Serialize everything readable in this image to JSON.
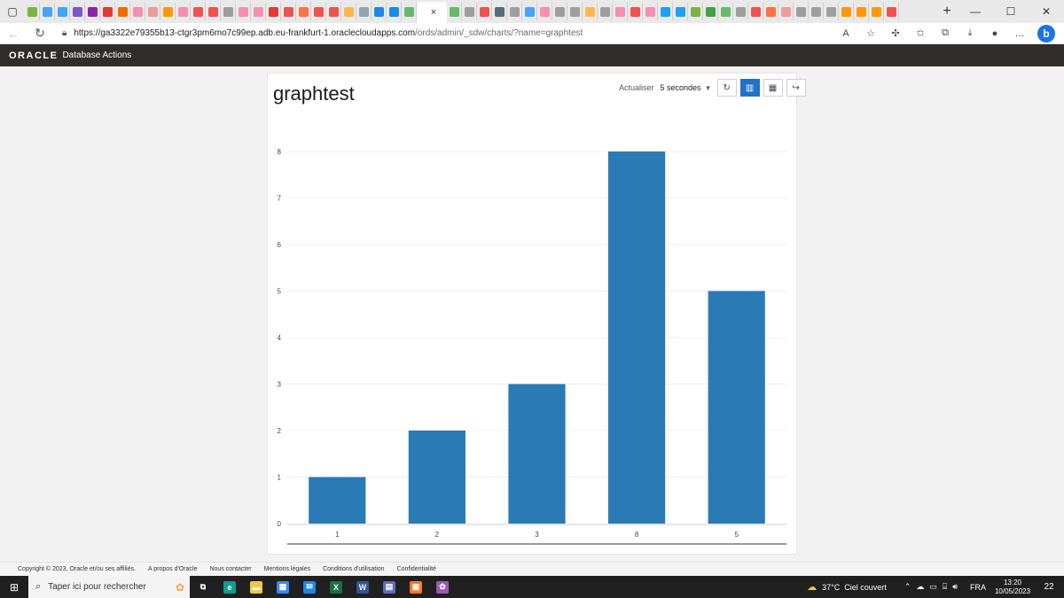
{
  "browser": {
    "tab_favicon_colors": [
      "#7cb342",
      "#42a5f5",
      "#42a5f5",
      "#7e57c2",
      "#8e24aa",
      "#e53935",
      "#ef6c00",
      "#f48fb1",
      "#ef9a9a",
      "#ff9800",
      "#f48fb1",
      "#ef5350",
      "#ef5350",
      "#9e9e9e",
      "#f48fb1",
      "#f48fb1",
      "#e53935",
      "#ef5350",
      "#ff7043",
      "#ef5350",
      "#ef5350",
      "#ffb74d",
      "#90a4ae",
      "#1e88e5",
      "#1e88e5",
      "#66bb6a"
    ],
    "right_favicon_colors": [
      "#66bb6a",
      "#9e9e9e",
      "#ef5350",
      "#546e7a",
      "#9e9e9e",
      "#42a5f5",
      "#f48fb1",
      "#9e9e9e",
      "#9e9e9e",
      "#ffb74d",
      "#9e9e9e",
      "#f48fb1",
      "#ef5350",
      "#f48fb1",
      "#1da1f2",
      "#1da1f2",
      "#7cb342",
      "#43a047",
      "#66bb6a",
      "#9e9e9e",
      "#ef5350",
      "#ff7043",
      "#ef9a9a",
      "#9e9e9e",
      "#9e9e9e",
      "#9e9e9e",
      "#ff9800",
      "#ff9800",
      "#ff9800",
      "#ef5350"
    ],
    "active_tab_close": "×",
    "new_tab": "+",
    "url_domain": "https://ga3322e79355b13-ctgr3pm6mo7c99ep.adb.eu-frankfurt-1.oraclecloudapps.com",
    "url_path": "/ords/admin/_sdw/charts/?name=graphtest",
    "bing_label": "b"
  },
  "app_header": {
    "logo": "ORACLE",
    "app_name": "Database Actions"
  },
  "chart_panel": {
    "title": "graphtest",
    "refresh_label": "Actualiser",
    "refresh_value": "5 secondes",
    "accent_color": "#1f72c8"
  },
  "chart_data": {
    "type": "bar",
    "categories": [
      "1",
      "2",
      "3",
      "8",
      "5"
    ],
    "values": [
      1,
      2,
      3,
      8,
      5
    ],
    "title": "graphtest",
    "xlabel": "",
    "ylabel": "",
    "ylim": [
      0,
      8
    ],
    "yticks": [
      0,
      1,
      2,
      3,
      4,
      5,
      6,
      7,
      8
    ],
    "grid": true,
    "bar_color": "#2a7ab5"
  },
  "footer": {
    "links": [
      "Copyright © 2023, Oracle et/ou ses affiliés.",
      "A propos d'Oracle",
      "Nous contacter",
      "Mentions légales",
      "Conditions d'utilisation",
      "Confidentialité"
    ]
  },
  "taskbar": {
    "search_placeholder": "Taper ici pour rechercher",
    "apps": [
      {
        "name": "task-view",
        "color": "#202020",
        "glyph": "⧉"
      },
      {
        "name": "edge",
        "color": "#0f9d8f",
        "glyph": "e"
      },
      {
        "name": "file-explorer",
        "color": "#f4c542",
        "glyph": "▬"
      },
      {
        "name": "store",
        "color": "#3a86ff",
        "glyph": "▦"
      },
      {
        "name": "mail",
        "color": "#1e88e5",
        "glyph": "✉"
      },
      {
        "name": "excel",
        "color": "#1d6f42",
        "glyph": "X"
      },
      {
        "name": "word",
        "color": "#2b579a",
        "glyph": "W"
      },
      {
        "name": "calculator",
        "color": "#5c6bc0",
        "glyph": "▤"
      },
      {
        "name": "xampp",
        "color": "#fb7a24",
        "glyph": "▣"
      },
      {
        "name": "app",
        "color": "#9b59b6",
        "glyph": "✿"
      }
    ],
    "weather_temp": "37°C",
    "weather_text": "Ciel couvert",
    "language": "FRA",
    "time": "13:20",
    "date": "10/05/2023",
    "notification_count": "22"
  }
}
